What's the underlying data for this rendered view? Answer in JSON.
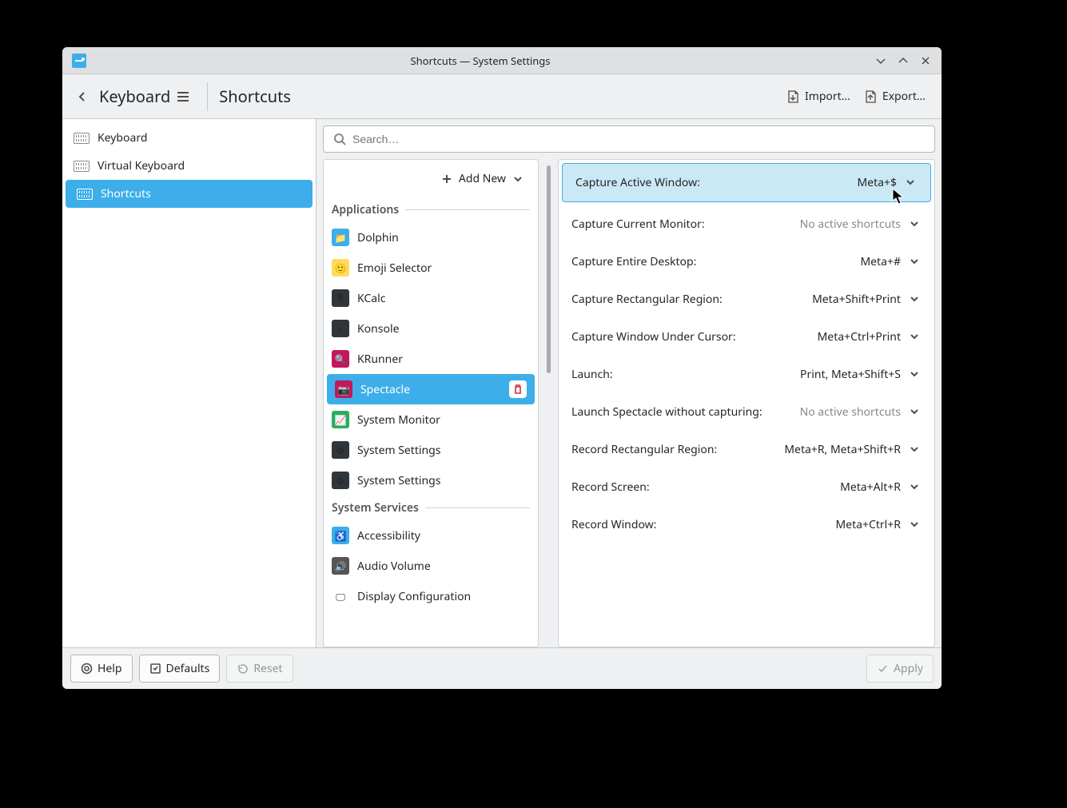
{
  "window_title": "Shortcuts — System Settings",
  "header": {
    "section": "Keyboard",
    "page": "Shortcuts",
    "import_label": "Import…",
    "export_label": "Export…"
  },
  "sidebar": {
    "items": [
      {
        "label": "Keyboard"
      },
      {
        "label": "Virtual Keyboard"
      },
      {
        "label": "Shortcuts",
        "selected": true
      }
    ]
  },
  "search": {
    "placeholder": "Search…"
  },
  "add_new_label": "Add New",
  "groups": [
    {
      "title": "Applications",
      "items": [
        {
          "label": "Dolphin",
          "icon_bg": "#3daee9",
          "glyph": "📁"
        },
        {
          "label": "Emoji Selector",
          "icon_bg": "#fddc5c",
          "glyph": "🙂"
        },
        {
          "label": "KCalc",
          "icon_bg": "#31363b",
          "glyph": "🖩"
        },
        {
          "label": "Konsole",
          "icon_bg": "#31363b",
          "glyph": ">"
        },
        {
          "label": "KRunner",
          "icon_bg": "#c2185b",
          "glyph": "🔍"
        },
        {
          "label": "Spectacle",
          "icon_bg": "#c2185b",
          "glyph": "📷",
          "selected": true
        },
        {
          "label": "System Monitor",
          "icon_bg": "#27ae60",
          "glyph": "📈"
        },
        {
          "label": "System Settings",
          "icon_bg": "#31363b",
          "glyph": "⚙"
        },
        {
          "label": "System Settings",
          "icon_bg": "#31363b",
          "glyph": "⚙"
        }
      ]
    },
    {
      "title": "System Services",
      "items": [
        {
          "label": "Accessibility",
          "icon_bg": "#3daee9",
          "glyph": "♿"
        },
        {
          "label": "Audio Volume",
          "icon_bg": "#555",
          "glyph": "🔊"
        },
        {
          "label": "Display Configuration",
          "icon_bg": "#fff",
          "glyph": "🖵"
        }
      ]
    }
  ],
  "shortcuts": [
    {
      "label": "Capture Active Window:",
      "keys": "Meta+$",
      "highlighted": true
    },
    {
      "label": "Capture Current Monitor:",
      "keys": "No active shortcuts",
      "inactive": true
    },
    {
      "label": "Capture Entire Desktop:",
      "keys": "Meta+#"
    },
    {
      "label": "Capture Rectangular Region:",
      "keys": "Meta+Shift+Print"
    },
    {
      "label": "Capture Window Under Cursor:",
      "keys": "Meta+Ctrl+Print"
    },
    {
      "label": "Launch:",
      "keys": "Print, Meta+Shift+S"
    },
    {
      "label": "Launch Spectacle without capturing:",
      "keys": "No active shortcuts",
      "inactive": true
    },
    {
      "label": "Record Rectangular Region:",
      "keys": "Meta+R, Meta+Shift+R"
    },
    {
      "label": "Record Screen:",
      "keys": "Meta+Alt+R"
    },
    {
      "label": "Record Window:",
      "keys": "Meta+Ctrl+R"
    }
  ],
  "footer": {
    "help": "Help",
    "defaults": "Defaults",
    "reset": "Reset",
    "apply": "Apply"
  }
}
